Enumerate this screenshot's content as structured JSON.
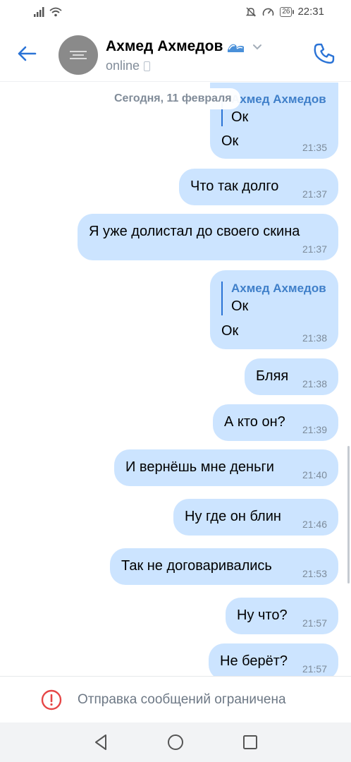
{
  "status_bar": {
    "time": "22:31",
    "battery": "26"
  },
  "header": {
    "contact_name": "Ахмед Ахмедов",
    "status": "online"
  },
  "chat": {
    "date_label": "Сегодня, 11 февраля",
    "messages": [
      {
        "reply_author": "Ахмед Ахмедов",
        "reply_text": "Ок",
        "text": "Ок",
        "time": "21:35"
      },
      {
        "text": "Что так долго",
        "time": "21:37"
      },
      {
        "text": "Я уже долистал до своего скина",
        "time": "21:37"
      },
      {
        "reply_author": "Ахмед Ахмедов",
        "reply_text": "Ок",
        "text": "Ок",
        "time": "21:38"
      },
      {
        "text": "Бляя",
        "time": "21:38"
      },
      {
        "text": "А кто он?",
        "time": "21:39"
      },
      {
        "text": "И вернёшь мне деньги",
        "time": "21:40"
      },
      {
        "text": "Ну где он блин",
        "time": "21:46"
      },
      {
        "text": "Так не договаривались",
        "time": "21:53"
      },
      {
        "text": "Ну что?",
        "time": "21:57"
      },
      {
        "text": "Не берёт?",
        "time": "21:57"
      }
    ]
  },
  "footer": {
    "restricted_text": "Отправка сообщений ограничена"
  },
  "colors": {
    "accent": "#2a73d6",
    "bubble": "#cce4ff",
    "warning": "#e64646"
  }
}
